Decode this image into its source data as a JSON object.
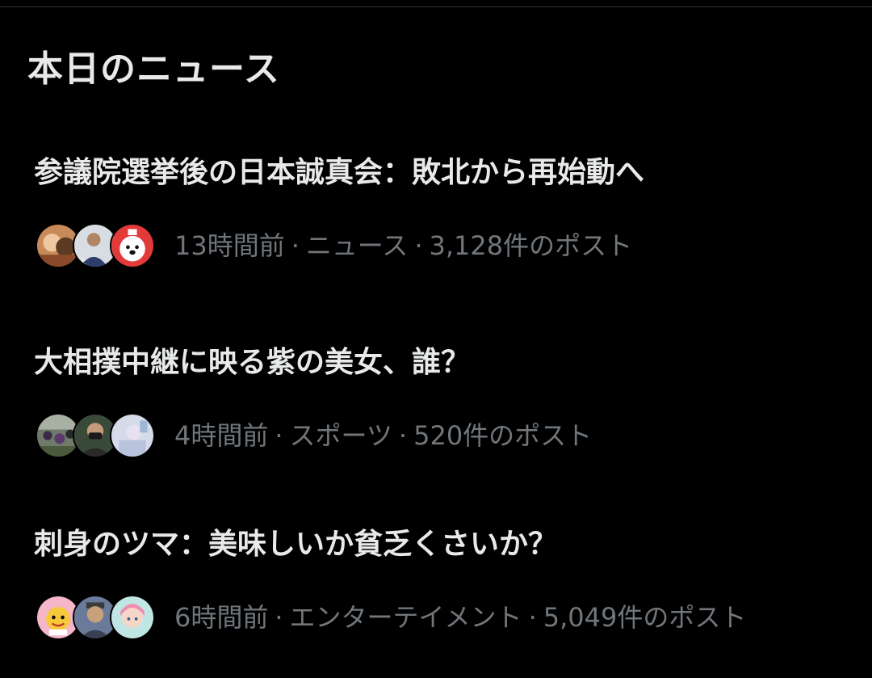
{
  "section": {
    "title": "本日のニュース"
  },
  "news": [
    {
      "headline": "参議院選挙後の日本誠真会：敗北から再始動へ",
      "time": "13時間前",
      "category": "ニュース",
      "posts": "3,128件のポスト",
      "avatars": [
        "avatar-person-with-dog",
        "avatar-man-suit",
        "avatar-dog-illustration"
      ]
    },
    {
      "headline": "大相撲中継に映る紫の美女、誰？",
      "time": "4時間前",
      "category": "スポーツ",
      "posts": "520件のポスト",
      "avatars": [
        "avatar-crowd-photo",
        "avatar-man-mask",
        "avatar-light-photo"
      ]
    },
    {
      "headline": "刺身のツマ：美味しいか貧乏くさいか？",
      "time": "6時間前",
      "category": "エンターテイメント",
      "posts": "5,049件のポスト",
      "avatars": [
        "avatar-cartoon-character",
        "avatar-man-portrait",
        "avatar-anime-girl"
      ]
    }
  ],
  "separator": "·",
  "colors": {
    "background": "#000000",
    "primary_text": "#e7e9ea",
    "secondary_text": "#71767b",
    "divider": "#2f3336"
  }
}
